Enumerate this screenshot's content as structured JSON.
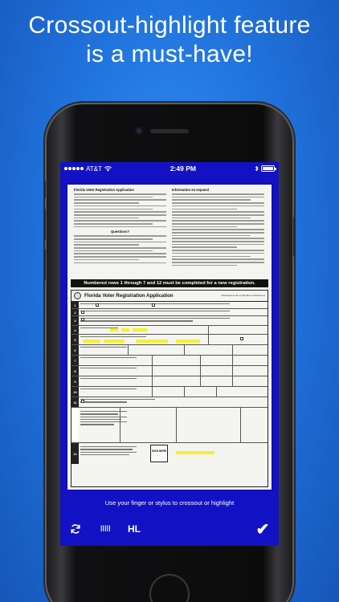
{
  "headline": {
    "line1": "Crossout-highlight feature",
    "line2": "is a must-have!"
  },
  "status_bar": {
    "carrier": "AT&T",
    "time": "2:49 PM"
  },
  "document": {
    "top_title": "Florida Voter Registration Application",
    "top_subtitle": "Information en espanol",
    "questions_heading": "Questions?",
    "banner": "Numbered rows 1 through 7 and 12 must be completed for a new registration.",
    "form_title": "Florida Voter Registration Application",
    "form_note": "Download at dos.myflorida.com/elections",
    "row_numbers": [
      "1",
      "2",
      "3",
      "4",
      "5",
      "6",
      "7",
      "8",
      "9",
      "10",
      "11",
      "12"
    ],
    "sign_here": "SIGN HERE"
  },
  "hint": "Use your finger or stylus to crossout or highlight",
  "toolbar": {
    "refresh_icon": "refresh-icon",
    "strike_label": "IIIII",
    "highlight_label": "HL",
    "done_icon": "checkmark-icon",
    "done_glyph": "✔"
  },
  "colors": {
    "background": "#1f6fd8",
    "screen": "#1212c4",
    "highlight": "#f2f21a"
  }
}
